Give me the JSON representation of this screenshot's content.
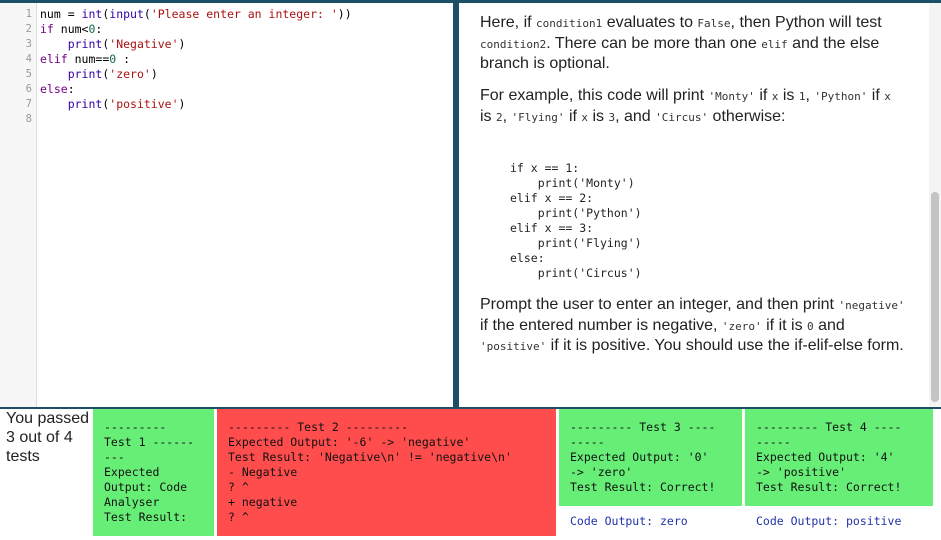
{
  "editor": {
    "line_numbers": [
      "1",
      "2",
      "3",
      "4",
      "5",
      "6",
      "7",
      "8"
    ],
    "code": {
      "l1": {
        "a": "num = ",
        "b": "int",
        "c": "(",
        "d": "input",
        "e": "(",
        "f": "'Please enter an integer: '",
        "g": "))"
      },
      "l2": {
        "a": "if",
        "b": " num<",
        "c": "0",
        "d": ":"
      },
      "l3": {
        "a": "    ",
        "b": "print",
        "c": "(",
        "d": "'Negative'",
        "e": ")"
      },
      "l4": {
        "a": "elif",
        "b": " num==",
        "c": "0",
        "d": " :"
      },
      "l5": {
        "a": "    ",
        "b": "print",
        "c": "(",
        "d": "'zero'",
        "e": ")"
      },
      "l6": {
        "a": "else",
        "b": ":"
      },
      "l7": {
        "a": "    ",
        "b": "print",
        "c": "(",
        "d": "'positive'",
        "e": ")"
      }
    }
  },
  "instructions": {
    "p1": {
      "t1": "Here, if ",
      "c1": "condition1",
      "t2": " evaluates to ",
      "c2": "False",
      "t3": ", then Python will test ",
      "c3": "condition2",
      "t4": ". There can be more than one ",
      "c4": "elif",
      "t5": " and the else branch is optional."
    },
    "p2": {
      "t1": "For example, this code will print ",
      "c1": "'Monty'",
      "t2": " if ",
      "c2": "x",
      "t3": " is ",
      "c3": "1",
      "t4": ", ",
      "c4": "'Python'",
      "t5": " if ",
      "c5": "x",
      "t6": " is ",
      "c6": "2",
      "t7": ", ",
      "c7": "'Flying'",
      "t8": " if ",
      "c8": "x",
      "t9": " is ",
      "c9": "3",
      "t10": ", and ",
      "c10": "'Circus'",
      "t11": " otherwise:"
    },
    "example_code": "if x == 1:\n    print('Monty')\nelif x == 2:\n    print('Python')\nelif x == 3:\n    print('Flying')\nelse:\n    print('Circus')",
    "p3": {
      "t1": "Prompt the user to enter an integer, and then print ",
      "c1": "'negative'",
      "t2": " if the entered number is negative, ",
      "c2": "'zero'",
      "t3": " if it is ",
      "c3": "0",
      "t4": " and ",
      "c4": "'positive'",
      "t5": " if it is positive. You should use the if-elif-else form."
    }
  },
  "results": {
    "summary": "You passed 3 out of 4 tests",
    "tests": [
      {
        "status": "pass",
        "text": "---------\nTest 1 ------\n---\nExpected\nOutput: Code\nAnalyser\nTest Result:",
        "code_output": ""
      },
      {
        "status": "fail",
        "text": "--------- Test 2 ---------\nExpected Output: '-6' -> 'negative'\nTest Result: 'Negative\\n' != 'negative\\n'\n- Negative\n? ^\n+ negative\n? ^",
        "code_output": ""
      },
      {
        "status": "pass",
        "text": "--------- Test 3 ----\n-----\nExpected Output: '0'\n-> 'zero'\nTest Result: Correct!",
        "code_output": "Code Output: zero"
      },
      {
        "status": "pass",
        "text": "--------- Test 4 ----\n-----\nExpected Output: '4'\n-> 'positive'\nTest Result: Correct!",
        "code_output": "Code Output: positive"
      }
    ]
  },
  "colors": {
    "pass": "#66ee77",
    "fail": "#ff4d4d",
    "divider": "#1d4f66",
    "keyword": "#770088",
    "builtin": "#3300aa",
    "string": "#aa1111",
    "number": "#116644"
  },
  "icons": []
}
